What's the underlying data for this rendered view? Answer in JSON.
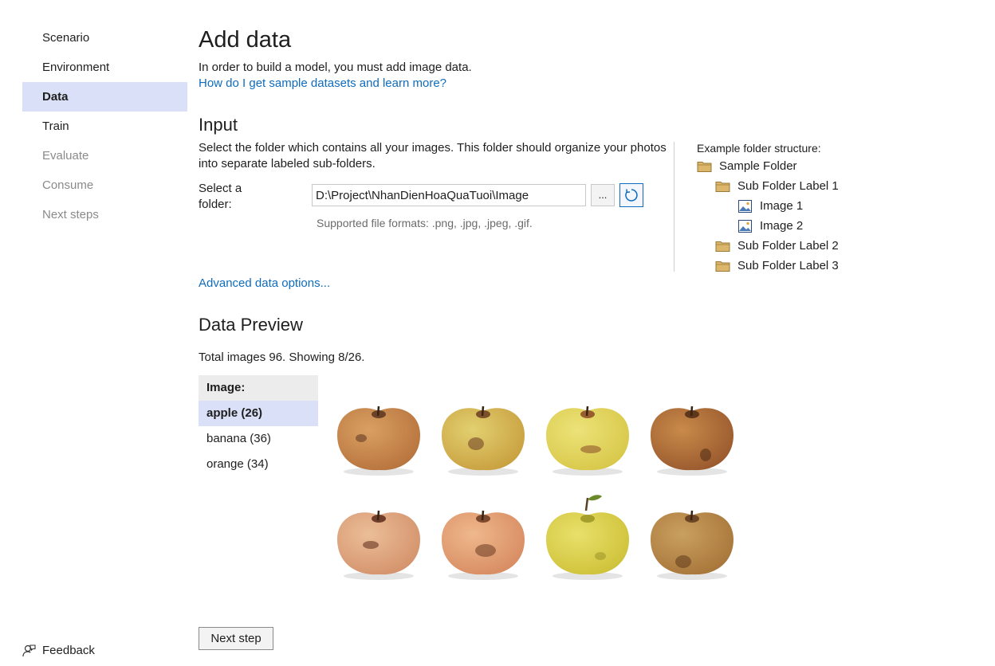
{
  "sidebar": {
    "items": [
      {
        "label": "Scenario",
        "state": "normal"
      },
      {
        "label": "Environment",
        "state": "normal"
      },
      {
        "label": "Data",
        "state": "selected"
      },
      {
        "label": "Train",
        "state": "normal"
      },
      {
        "label": "Evaluate",
        "state": "disabled"
      },
      {
        "label": "Consume",
        "state": "disabled"
      },
      {
        "label": "Next steps",
        "state": "disabled"
      }
    ],
    "feedback_label": "Feedback",
    "feedback_icon": "feedback-person-icon"
  },
  "main": {
    "title": "Add data",
    "intro": "In order to build a model, you must add image data.",
    "help_link": "How do I get sample datasets and learn more?",
    "input": {
      "title": "Input",
      "description": "Select the folder which contains all your images. This folder should organize your photos into separate labeled sub-folders.",
      "folder_label": "Select a folder:",
      "folder_value": "D:\\Project\\NhanDienHoaQuaTuoi\\Image",
      "browse_label": "...",
      "refresh_icon": "refresh-icon",
      "formats": "Supported file formats: .png, .jpg, .jpeg, .gif."
    },
    "example": {
      "title": "Example folder structure:",
      "tree": [
        {
          "label": "Sample Folder",
          "type": "folder",
          "level": 0
        },
        {
          "label": "Sub Folder Label 1",
          "type": "folder",
          "level": 1
        },
        {
          "label": "Image 1",
          "type": "image",
          "level": 2
        },
        {
          "label": "Image 2",
          "type": "image",
          "level": 2
        },
        {
          "label": "Sub Folder Label 2",
          "type": "folder",
          "level": 1
        },
        {
          "label": "Sub Folder Label 3",
          "type": "folder",
          "level": 1
        }
      ]
    },
    "advanced_link": "Advanced data options...",
    "preview": {
      "title": "Data Preview",
      "totals": "Total images 96. Showing 8/26.",
      "table_header": "Image:",
      "labels": [
        {
          "name": "apple",
          "count": "(26)",
          "selected": true
        },
        {
          "name": "banana",
          "count": "(36)",
          "selected": false
        },
        {
          "name": "orange",
          "count": "(34)",
          "selected": false
        }
      ],
      "images": [
        {
          "name": "rotten-apple-1",
          "skin": "#b8743e",
          "highlight": "#d9a062",
          "spot": "#5a3520",
          "leaf": false
        },
        {
          "name": "rotten-apple-2",
          "skin": "#c9a040",
          "highlight": "#e2d070",
          "spot": "#6b3d22",
          "leaf": false
        },
        {
          "name": "rotten-apple-3",
          "skin": "#d8c84a",
          "highlight": "#ece278",
          "spot": "#8a4a26",
          "leaf": false
        },
        {
          "name": "rotten-apple-4",
          "skin": "#9a5a2e",
          "highlight": "#c98a4a",
          "spot": "#4e2c16",
          "leaf": false
        },
        {
          "name": "rotten-apple-5",
          "skin": "#d4936c",
          "highlight": "#ebbe98",
          "spot": "#5a2a1a",
          "leaf": false
        },
        {
          "name": "rotten-apple-6",
          "skin": "#d88c62",
          "highlight": "#efb88c",
          "spot": "#6a3a22",
          "leaf": false
        },
        {
          "name": "rotten-apple-7",
          "skin": "#cfc23a",
          "highlight": "#e8e06a",
          "spot": "#9a9426",
          "leaf": true
        },
        {
          "name": "rotten-apple-8",
          "skin": "#a8763a",
          "highlight": "#c9a060",
          "spot": "#5e3a1c",
          "leaf": false
        }
      ]
    },
    "next_button": "Next step"
  },
  "colors": {
    "accent": "#0f6cbd",
    "selected_bg": "#dae0f7",
    "folder": "#dcb66a"
  }
}
